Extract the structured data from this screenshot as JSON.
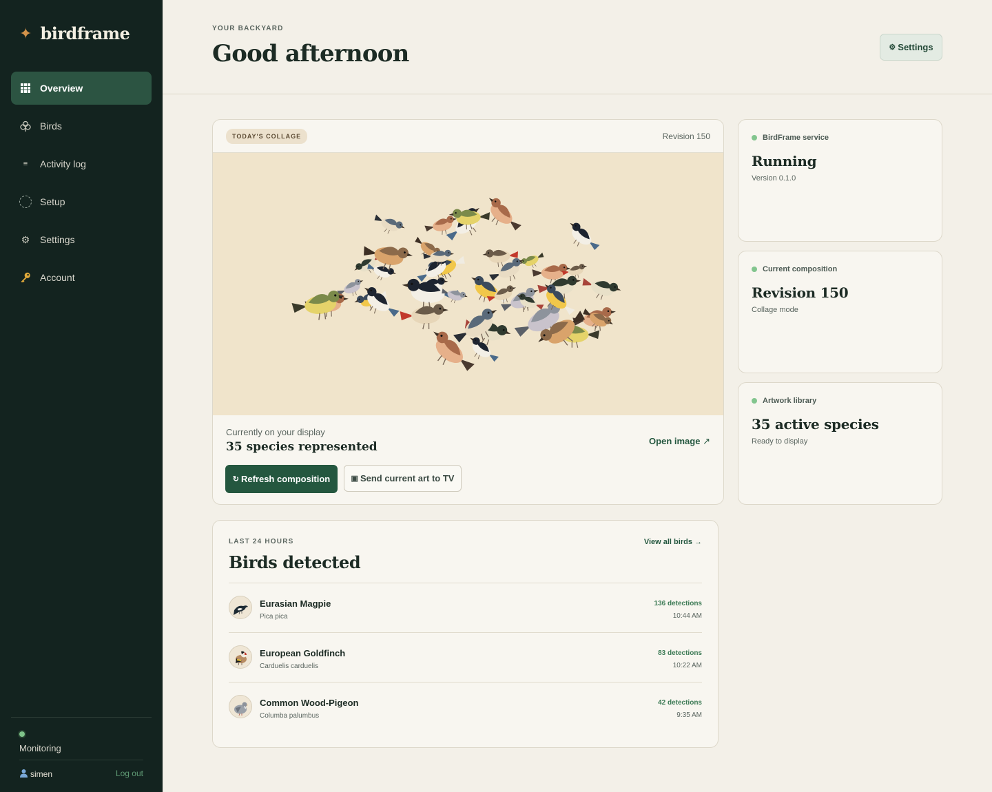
{
  "brand": {
    "name": "birdframe",
    "icon": "star-icon",
    "accent": "#d4934a"
  },
  "sidebar": {
    "items": [
      {
        "label": "Overview",
        "icon": "grid-icon",
        "active": true
      },
      {
        "label": "Birds",
        "icon": "bird-icon",
        "active": false
      },
      {
        "label": "Activity log",
        "icon": "list-icon",
        "active": false
      },
      {
        "label": "Setup",
        "icon": "dashed-circle-icon",
        "active": false
      },
      {
        "label": "Settings",
        "icon": "gear-icon",
        "active": false
      },
      {
        "label": "Account",
        "icon": "key-icon",
        "active": false
      }
    ],
    "status": "Monitoring",
    "user": "simen",
    "logout": "Log out"
  },
  "header": {
    "eyebrow": "YOUR BACKYARD",
    "title": "Good afternoon",
    "settings_button": "Settings"
  },
  "collage": {
    "tag": "TODAY'S COLLAGE",
    "revision": "Revision 150",
    "display_label": "Currently on your display",
    "display_value": "35 species represented",
    "open_link": "Open image",
    "refresh_button": "Refresh composition",
    "send_button": "Send current art to TV"
  },
  "status_cards": [
    {
      "label": "BirdFrame service",
      "value": "Running",
      "sub": "Version 0.1.0"
    },
    {
      "label": "Current composition",
      "value": "Revision 150",
      "sub": "Collage mode"
    },
    {
      "label": "Artwork library",
      "value": "35 active species",
      "sub": "Ready to display"
    }
  ],
  "birds_detected": {
    "eyebrow": "LAST 24 HOURS",
    "title": "Birds detected",
    "view_all": "View all birds →",
    "rows": [
      {
        "name": "Eurasian Magpie",
        "scientific": "Pica pica",
        "detections": "136 detections",
        "time": "10:44 AM"
      },
      {
        "name": "European Goldfinch",
        "scientific": "Carduelis carduelis",
        "detections": "83 detections",
        "time": "10:22 AM"
      },
      {
        "name": "Common Wood-Pigeon",
        "scientific": "Columba palumbus",
        "detections": "42 detections",
        "time": "9:35 AM"
      }
    ]
  },
  "colors": {
    "sidebar_bg": "#13231f",
    "primary": "#24573f",
    "background": "#f3f0e8",
    "status_dot": "#82c58e"
  }
}
